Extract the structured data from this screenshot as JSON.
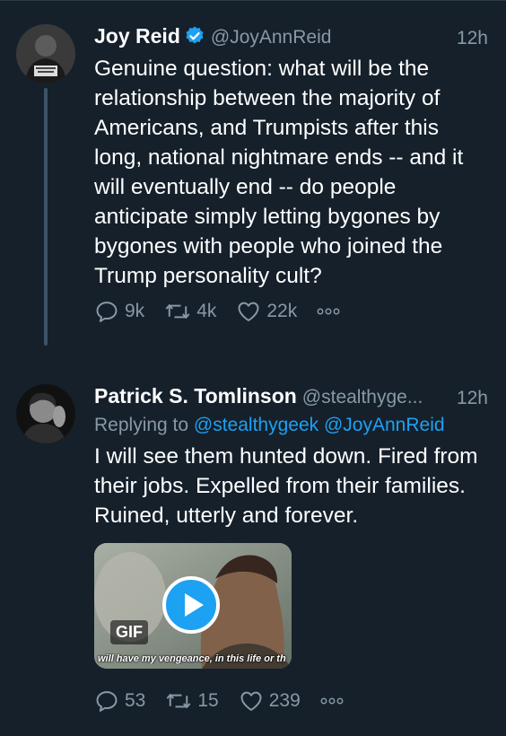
{
  "tweets": [
    {
      "name": "Joy Reid",
      "handle": "@JoyAnnReid",
      "time": "12h",
      "verified": true,
      "text": "Genuine question: what will be the relationship between the majority of Americans, and Trumpists after this long, national nightmare ends -- and it will eventually end -- do people anticipate simply letting bygones by bygones with people who joined the Trump personality cult?",
      "replies": "9k",
      "retweets": "4k",
      "likes": "22k"
    },
    {
      "name": "Patrick S. Tomlinson",
      "handle": "@stealthyge...",
      "time": "12h",
      "replying_label": "Replying to",
      "replying_to": [
        "@stealthygeek",
        "@JoyAnnReid"
      ],
      "text": "I will see them hunted down. Fired from their jobs. Expelled from their families. Ruined, utterly and forever.",
      "media": {
        "badge": "GIF",
        "caption": "will have my vengeance, in this life or th"
      },
      "replies": "53",
      "retweets": "15",
      "likes": "239"
    }
  ],
  "colors": {
    "background": "#15202b",
    "secondary_text": "#8899a6",
    "link": "#1da1f2",
    "thread_line": "#3d5466"
  }
}
